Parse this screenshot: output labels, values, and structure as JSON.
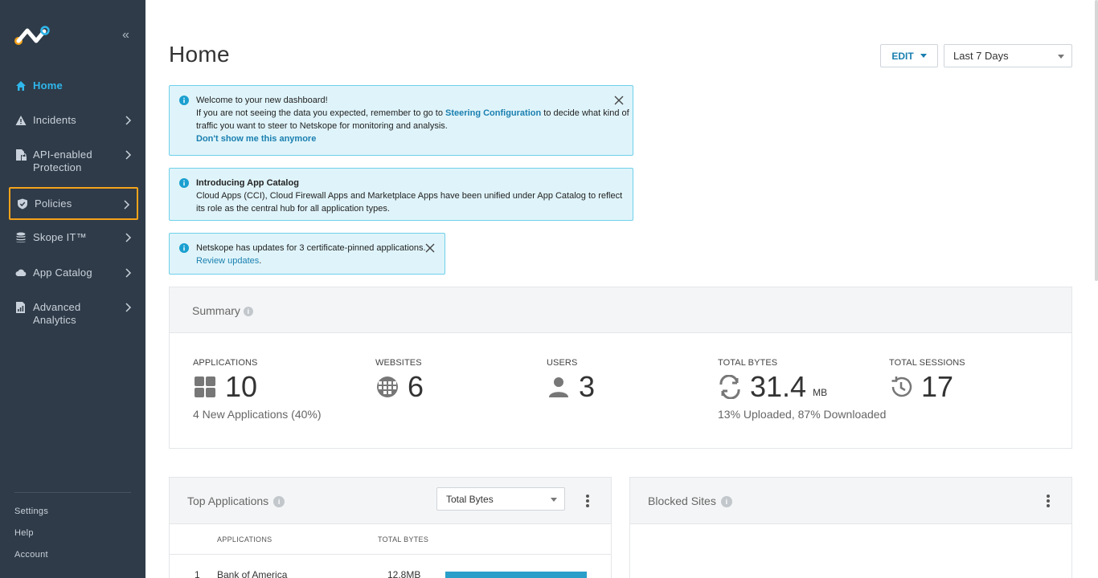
{
  "sidebar": {
    "items": [
      {
        "label": "Home",
        "icon": "home-icon"
      },
      {
        "label": "Incidents",
        "icon": "warning-icon"
      },
      {
        "label": "API-enabled Protection",
        "icon": "document-lock-icon"
      },
      {
        "label": "Policies",
        "icon": "shield-icon"
      },
      {
        "label": "Skope IT™",
        "icon": "database-icon"
      },
      {
        "label": "App Catalog",
        "icon": "cloud-icon"
      },
      {
        "label": "Advanced Analytics",
        "icon": "analytics-icon"
      }
    ],
    "footer": [
      "Settings",
      "Help",
      "Account"
    ]
  },
  "header": {
    "title": "Home",
    "edit_label": "EDIT",
    "range_value": "Last 7 Days"
  },
  "alerts": {
    "welcome": {
      "title": "Welcome to your new dashboard!",
      "line1_pre": "If you are not seeing the data you expected, remember to go to ",
      "line1_link": "Steering Configuration",
      "line1_post": " to decide what kind of",
      "line2": "traffic you want to steer to Netskope for monitoring and analysis.",
      "dismiss": "Don't show me this anymore"
    },
    "catalog": {
      "title": "Introducing App Catalog",
      "line1": "Cloud Apps (CCI), Cloud Firewall Apps and Marketplace Apps have been unified under App Catalog to reflect",
      "line2": "its role as the central hub for all application types."
    },
    "certs": {
      "text": "Netskope has updates for 3 certificate-pinned applications.",
      "link": "Review updates",
      "link_suffix": "."
    }
  },
  "summary": {
    "title": "Summary",
    "metrics": [
      {
        "label": "APPLICATIONS",
        "value": "10",
        "unit": "",
        "sub": "4 New Applications (40%)",
        "icon": "apps-grid-icon"
      },
      {
        "label": "WEBSITES",
        "value": "6",
        "unit": "",
        "sub": "",
        "icon": "globe-icon"
      },
      {
        "label": "USERS",
        "value": "3",
        "unit": "",
        "sub": "",
        "icon": "user-icon"
      },
      {
        "label": "TOTAL BYTES",
        "value": "31.4",
        "unit": "MB",
        "sub": "13% Uploaded, 87% Downloaded",
        "icon": "transfer-icon"
      },
      {
        "label": "TOTAL SESSIONS",
        "value": "17",
        "unit": "",
        "sub": "",
        "icon": "history-icon"
      }
    ]
  },
  "top_apps": {
    "title": "Top Applications",
    "metric_select": "Total Bytes",
    "columns": [
      "APPLICATIONS",
      "TOTAL BYTES"
    ],
    "rows": [
      {
        "rank": "1",
        "name": "Bank of America",
        "bytes": "12.8MB"
      }
    ]
  },
  "blocked_sites": {
    "title": "Blocked Sites"
  },
  "colors": {
    "sidebar_bg": "#2f3b48",
    "accent": "#2fb7ec",
    "link": "#1a7fb0",
    "highlight": "#f5a31a",
    "alert_bg": "#dff4fa",
    "bar": "#2a9fc9"
  }
}
